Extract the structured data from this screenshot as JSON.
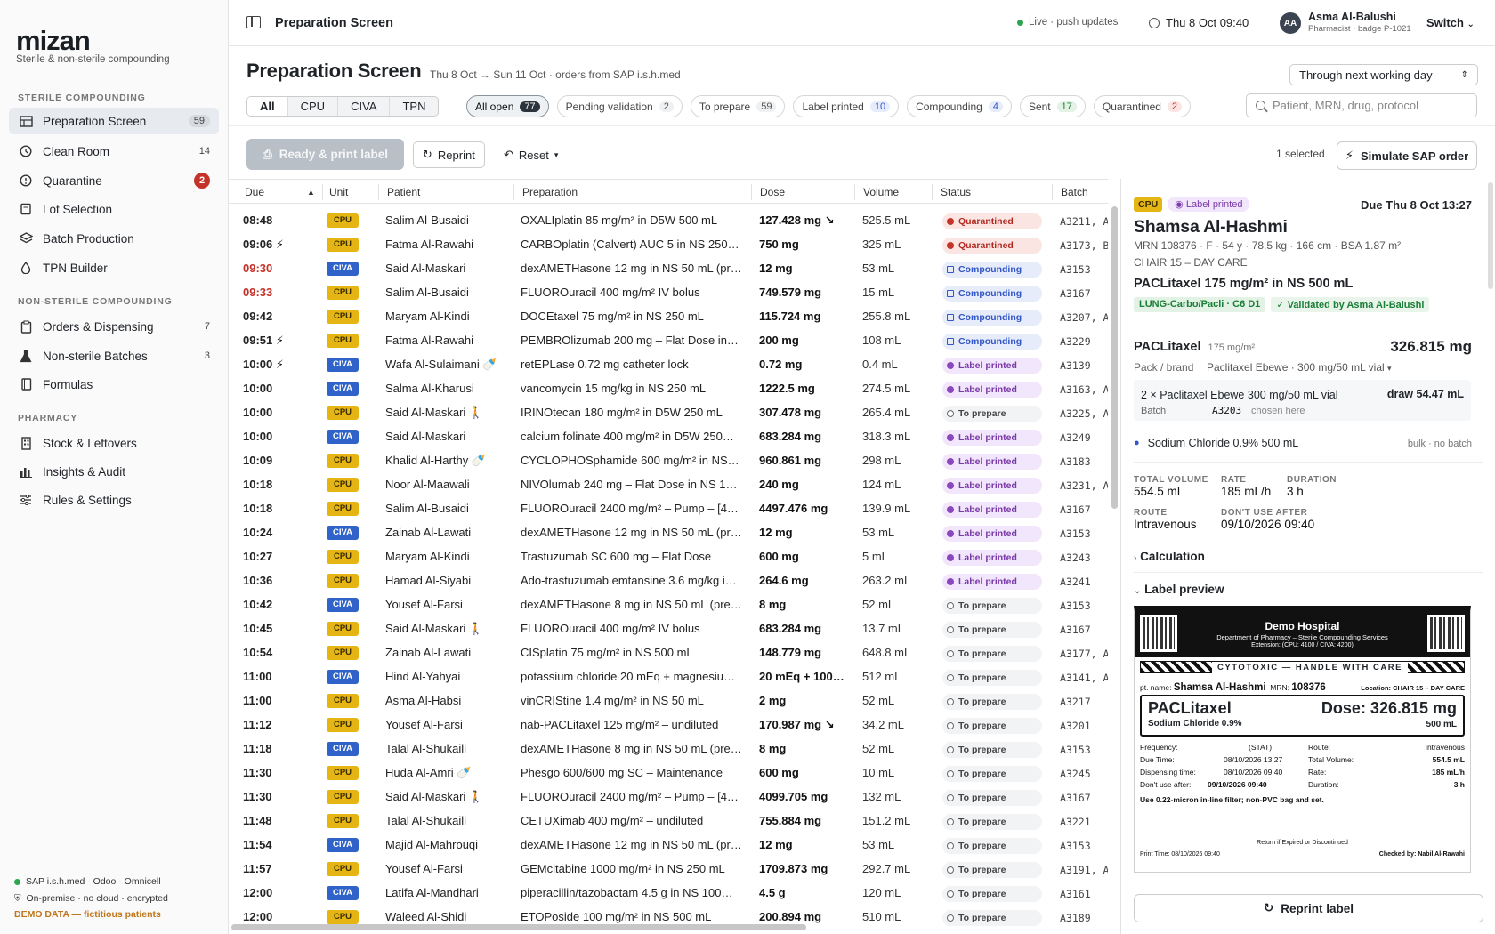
{
  "app": {
    "logo": "mizan",
    "tagline": "Sterile & non-sterile compounding"
  },
  "sidebar": {
    "sections": [
      {
        "title": "STERILE COMPOUNDING",
        "items": [
          {
            "label": "Preparation Screen",
            "count": "59",
            "icon": "table-icon",
            "active": true
          },
          {
            "label": "Clean Room",
            "count": "14",
            "icon": "clock-icon"
          },
          {
            "label": "Quarantine",
            "count": "2",
            "icon": "alert-icon",
            "alert": true
          },
          {
            "label": "Lot Selection",
            "count": "",
            "icon": "box-icon"
          },
          {
            "label": "Batch Production",
            "count": "",
            "icon": "layers-icon"
          },
          {
            "label": "TPN Builder",
            "count": "",
            "icon": "drop-icon"
          }
        ]
      },
      {
        "title": "NON-STERILE COMPOUNDING",
        "items": [
          {
            "label": "Orders & Dispensing",
            "count": "7",
            "icon": "clipboard-icon"
          },
          {
            "label": "Non-sterile Batches",
            "count": "3",
            "icon": "flask-icon"
          },
          {
            "label": "Formulas",
            "count": "",
            "icon": "book-icon"
          }
        ]
      },
      {
        "title": "PHARMACY",
        "items": [
          {
            "label": "Stock & Leftovers",
            "count": "",
            "icon": "building-icon"
          },
          {
            "label": "Insights & Audit",
            "count": "",
            "icon": "bar-chart-icon"
          },
          {
            "label": "Rules & Settings",
            "count": "",
            "icon": "sliders-icon"
          }
        ]
      }
    ],
    "footer": [
      "SAP i.s.h.med · Odoo · Omnicell",
      "On-premise · no cloud · encrypted",
      "DEMO DATA — fictitious patients"
    ]
  },
  "topbar": {
    "title": "Preparation Screen",
    "live": "Live · push updates",
    "datetime": "Thu 8 Oct  09:40",
    "user_initials": "AA",
    "user_name": "Asma Al-Balushi",
    "user_role": "Pharmacist · badge P-1021",
    "switch": "Switch"
  },
  "page": {
    "title": "Preparation Screen",
    "subtitle": "Thu 8 Oct → Sun 11 Oct · orders from SAP i.s.h.med",
    "range": "Through next working day"
  },
  "unit_tabs": [
    "All",
    "CPU",
    "CIVA",
    "TPN"
  ],
  "filters": [
    {
      "label": "All open",
      "count": "77"
    },
    {
      "label": "Pending validation",
      "count": "2"
    },
    {
      "label": "To prepare",
      "count": "59"
    },
    {
      "label": "Label printed",
      "count": "10"
    },
    {
      "label": "Compounding",
      "count": "4"
    },
    {
      "label": "Sent",
      "count": "17"
    },
    {
      "label": "Quarantined",
      "count": "2"
    }
  ],
  "search_placeholder": "Patient, MRN, drug, protocol",
  "actions": {
    "ready": "Ready & print label",
    "reprint": "Reprint",
    "reset": "Reset",
    "selected": "1 selected",
    "simulate": "Simulate SAP order"
  },
  "columns": [
    "Due",
    "Unit",
    "Patient",
    "Preparation",
    "Dose",
    "Volume",
    "Status",
    "Batch"
  ],
  "rows": [
    {
      "due": "08:48",
      "unit": "CPU",
      "patient": "Salim Al-Busaidi",
      "prep": "OXALIplatin 85 mg/m² in D5W 500 mL",
      "dose": "127.428 mg ↘",
      "vol": "525.5 mL",
      "status": "Quarantined",
      "batch": "A3211, A"
    },
    {
      "due": "09:06 ⚡",
      "unit": "CPU",
      "patient": "Fatma Al-Rawahi",
      "prep": "CARBOplatin (Calvert) AUC 5 in NS 250…",
      "dose": "750 mg",
      "vol": "325 mL",
      "status": "Quarantined",
      "batch": "A3173, B"
    },
    {
      "due": "09:30",
      "late": true,
      "unit": "CIVA",
      "patient": "Said Al-Maskari",
      "prep": "dexAMETHasone 12 mg in NS 50 mL (pr…",
      "dose": "12 mg",
      "vol": "53 mL",
      "status": "Compounding",
      "batch": "A3153"
    },
    {
      "due": "09:33",
      "late": true,
      "unit": "CPU",
      "patient": "Salim Al-Busaidi",
      "prep": "FLUOROuracil 400 mg/m² IV bolus",
      "dose": "749.579 mg",
      "vol": "15 mL",
      "status": "Compounding",
      "batch": "A3167"
    },
    {
      "due": "09:42",
      "unit": "CPU",
      "patient": "Maryam Al-Kindi",
      "prep": "DOCEtaxel 75 mg/m² in NS 250 mL",
      "dose": "115.724 mg",
      "vol": "255.8 mL",
      "status": "Compounding",
      "batch": "A3207, A"
    },
    {
      "due": "09:51 ⚡",
      "unit": "CPU",
      "patient": "Fatma Al-Rawahi",
      "prep": "PEMBROlizumab 200 mg – Flat Dose in…",
      "dose": "200 mg",
      "vol": "108 mL",
      "status": "Compounding",
      "batch": "A3229"
    },
    {
      "due": "10:00 ⚡",
      "unit": "CIVA",
      "patient": "Wafa Al-Sulaimani 🍼",
      "prep": "retEPLase 0.72 mg catheter lock",
      "dose": "0.72 mg",
      "vol": "0.4 mL",
      "status": "Label printed",
      "batch": "A3139"
    },
    {
      "due": "10:00",
      "unit": "CIVA",
      "patient": "Salma Al-Kharusi",
      "prep": "vancomycin 15 mg/kg in NS 250 mL",
      "dose": "1222.5 mg",
      "vol": "274.5 mL",
      "status": "Label printed",
      "batch": "A3163, A"
    },
    {
      "due": "10:00",
      "unit": "CPU",
      "patient": "Said Al-Maskari 🚶",
      "prep": "IRINOtecan 180 mg/m² in D5W 250 mL",
      "dose": "307.478 mg",
      "vol": "265.4 mL",
      "status": "To prepare",
      "batch": "A3225, A"
    },
    {
      "due": "10:00",
      "unit": "CIVA",
      "patient": "Said Al-Maskari",
      "prep": "calcium folinate 400 mg/m² in D5W 250…",
      "dose": "683.284 mg",
      "vol": "318.3 mL",
      "status": "Label printed",
      "batch": "A3249"
    },
    {
      "due": "10:09",
      "unit": "CPU",
      "patient": "Khalid Al-Harthy 🍼",
      "prep": "CYCLOPHOSphamide 600 mg/m² in NS…",
      "dose": "960.861 mg",
      "vol": "298 mL",
      "status": "Label printed",
      "batch": "A3183"
    },
    {
      "due": "10:18",
      "unit": "CPU",
      "patient": "Noor Al-Maawali",
      "prep": "NIVOlumab 240 mg – Flat Dose in NS 10…",
      "dose": "240 mg",
      "vol": "124 mL",
      "status": "Label printed",
      "batch": "A3231, A"
    },
    {
      "due": "10:18",
      "unit": "CPU",
      "patient": "Salim Al-Busaidi",
      "prep": "FLUOROuracil 2400 mg/m² – Pump – [4…",
      "dose": "4497.476 mg",
      "vol": "139.9 mL",
      "status": "Label printed",
      "batch": "A3167"
    },
    {
      "due": "10:24",
      "unit": "CIVA",
      "patient": "Zainab Al-Lawati",
      "prep": "dexAMETHasone 12 mg in NS 50 mL (pr…",
      "dose": "12 mg",
      "vol": "53 mL",
      "status": "Label printed",
      "batch": "A3153"
    },
    {
      "due": "10:27",
      "unit": "CPU",
      "patient": "Maryam Al-Kindi",
      "prep": "Trastuzumab SC 600 mg – Flat Dose",
      "dose": "600 mg",
      "vol": "5 mL",
      "status": "Label printed",
      "batch": "A3243"
    },
    {
      "due": "10:36",
      "unit": "CPU",
      "patient": "Hamad Al-Siyabi",
      "prep": "Ado-trastuzumab emtansine 3.6 mg/kg i…",
      "dose": "264.6 mg",
      "vol": "263.2 mL",
      "status": "Label printed",
      "batch": "A3241"
    },
    {
      "due": "10:42",
      "unit": "CIVA",
      "patient": "Yousef Al-Farsi",
      "prep": "dexAMETHasone 8 mg in NS 50 mL (pre…",
      "dose": "8 mg",
      "vol": "52 mL",
      "status": "To prepare",
      "batch": "A3153"
    },
    {
      "due": "10:45",
      "unit": "CPU",
      "patient": "Said Al-Maskari 🚶",
      "prep": "FLUOROuracil 400 mg/m² IV bolus",
      "dose": "683.284 mg",
      "vol": "13.7 mL",
      "status": "To prepare",
      "batch": "A3167"
    },
    {
      "due": "10:54",
      "unit": "CPU",
      "patient": "Zainab Al-Lawati",
      "prep": "CISplatin 75 mg/m² in NS 500 mL",
      "dose": "148.779 mg",
      "vol": "648.8 mL",
      "status": "To prepare",
      "batch": "A3177, A"
    },
    {
      "due": "11:00",
      "unit": "CIVA",
      "patient": "Hind Al-Yahyai",
      "prep": "potassium chloride 20 mEq + magnesiu…",
      "dose": "20 mEq + 100…",
      "vol": "512 mL",
      "status": "To prepare",
      "batch": "A3141, A"
    },
    {
      "due": "11:00",
      "unit": "CPU",
      "patient": "Asma Al-Habsi",
      "prep": "vinCRIStine 1.4 mg/m² in NS 50 mL",
      "dose": "2 mg",
      "vol": "52 mL",
      "status": "To prepare",
      "batch": "A3217"
    },
    {
      "due": "11:12",
      "unit": "CPU",
      "patient": "Yousef Al-Farsi",
      "prep": "nab-PACLitaxel 125 mg/m² – undiluted",
      "dose": "170.987 mg ↘",
      "vol": "34.2 mL",
      "status": "To prepare",
      "batch": "A3201"
    },
    {
      "due": "11:18",
      "unit": "CIVA",
      "patient": "Talal Al-Shukaili",
      "prep": "dexAMETHasone 8 mg in NS 50 mL (pre…",
      "dose": "8 mg",
      "vol": "52 mL",
      "status": "To prepare",
      "batch": "A3153"
    },
    {
      "due": "11:30",
      "unit": "CPU",
      "patient": "Huda Al-Amri 🍼",
      "prep": "Phesgo 600/600 mg SC – Maintenance",
      "dose": "600 mg",
      "vol": "10 mL",
      "status": "To prepare",
      "batch": "A3245"
    },
    {
      "due": "11:30",
      "unit": "CPU",
      "patient": "Said Al-Maskari 🚶",
      "prep": "FLUOROuracil 2400 mg/m² – Pump – [4…",
      "dose": "4099.705 mg",
      "vol": "132 mL",
      "status": "To prepare",
      "batch": "A3167"
    },
    {
      "due": "11:48",
      "unit": "CPU",
      "patient": "Talal Al-Shukaili",
      "prep": "CETUXimab 400 mg/m² – undiluted",
      "dose": "755.884 mg",
      "vol": "151.2 mL",
      "status": "To prepare",
      "batch": "A3221"
    },
    {
      "due": "11:54",
      "unit": "CIVA",
      "patient": "Majid Al-Mahrouqi",
      "prep": "dexAMETHasone 12 mg in NS 50 mL (pr…",
      "dose": "12 mg",
      "vol": "53 mL",
      "status": "To prepare",
      "batch": "A3153"
    },
    {
      "due": "11:57",
      "unit": "CPU",
      "patient": "Yousef Al-Farsi",
      "prep": "GEMcitabine 1000 mg/m² in NS 250 mL",
      "dose": "1709.873 mg",
      "vol": "292.7 mL",
      "status": "To prepare",
      "batch": "A3191, A"
    },
    {
      "due": "12:00",
      "unit": "CIVA",
      "patient": "Latifa Al-Mandhari",
      "prep": "piperacillin/tazobactam 4.5 g in NS 100…",
      "dose": "4.5 g",
      "vol": "120 mL",
      "status": "To prepare",
      "batch": "A3161"
    },
    {
      "due": "12:00",
      "unit": "CPU",
      "patient": "Waleed Al-Shidi",
      "prep": "ETOPoside 100 mg/m² in NS 500 mL",
      "dose": "200.894 mg",
      "vol": "510 mL",
      "status": "To prepare",
      "batch": "A3189"
    }
  ],
  "detail": {
    "unit": "CPU",
    "status": "Label printed",
    "due": "Due Thu 8 Oct 13:27",
    "patient": "Shamsa Al-Hashmi",
    "meta": "MRN 108376 · F · 54 y · 78.5 kg · 166 cm · BSA 1.87 m²",
    "location": "CHAIR 15 – DAY CARE",
    "drug": "PACLitaxel 175 mg/m² in NS 500 mL",
    "protocol": "LUNG-Carbo/Pacli · C6 D1",
    "validated": "✓ Validated by Asma Al-Balushi",
    "component": "PACLitaxel",
    "component_dose_unit": "175 mg/m²",
    "component_dose": "326.815 mg",
    "pack_label": "Pack / brand",
    "pack_value": "Paclitaxel Ebewe · 300 mg/50 mL vial",
    "vial_line": "2 × Paclitaxel Ebewe 300 mg/50 mL vial",
    "draw": "draw 54.47 mL",
    "batch_label": "Batch",
    "batch_value": "A3203",
    "batch_note": "chosen here",
    "diluent": "Sodium Chloride 0.9% 500 mL",
    "diluent_note": "bulk · no batch",
    "total_volume_l": "TOTAL VOLUME",
    "total_volume": "554.5 mL",
    "rate_l": "RATE",
    "rate": "185 mL/h",
    "duration_l": "DURATION",
    "duration": "3 h",
    "route_l": "ROUTE",
    "route": "Intravenous",
    "dnua_l": "DON'T USE AFTER",
    "dnua": "09/10/2026 09:40",
    "calc": "Calculation",
    "preview": "Label preview",
    "reprint": "Reprint label"
  },
  "label": {
    "hospital": "Demo Hospital",
    "dept": "Department of Pharmacy – Sterile Compounding Services",
    "ext": "Extension: (CPU: 4100 / CIVA: 4200)",
    "hazard": "CYTOTOXIC — HANDLE WITH CARE",
    "pt_l": "pt. name:",
    "pt": "Shamsa Al-Hashmi",
    "mrn_l": "MRN:",
    "mrn": "108376",
    "loc": "Location: CHAIR 15 – DAY CARE",
    "drug": "PACLitaxel",
    "diluent": "Sodium Chloride 0.9%",
    "dose": "Dose: 326.815 mg",
    "vol": "500 mL",
    "freq_l": "Frequency:",
    "freq": "(STAT)",
    "route_l": "Route:",
    "route": "Intravenous",
    "due_l": "Due Time:",
    "due": "08/10/2026 13:27",
    "tv_l": "Total Volume:",
    "tv": "554.5 mL",
    "disp_l": "Dispensing time:",
    "disp": "08/10/2026 09:40",
    "rate_l": "Rate:",
    "rate": "185 mL/h",
    "dnua_l": "Don't use after:",
    "dnua": "09/10/2026 09:40",
    "dur_l": "Duration:",
    "dur": "3 h",
    "note": "Use 0.22-micron in-line filter; non-PVC bag and set.",
    "return": "Return if Expired or Discontinued",
    "print": "Print Time: 08/10/2026 09:40",
    "checked": "Checked by: Nabil Al-Rawahi"
  }
}
